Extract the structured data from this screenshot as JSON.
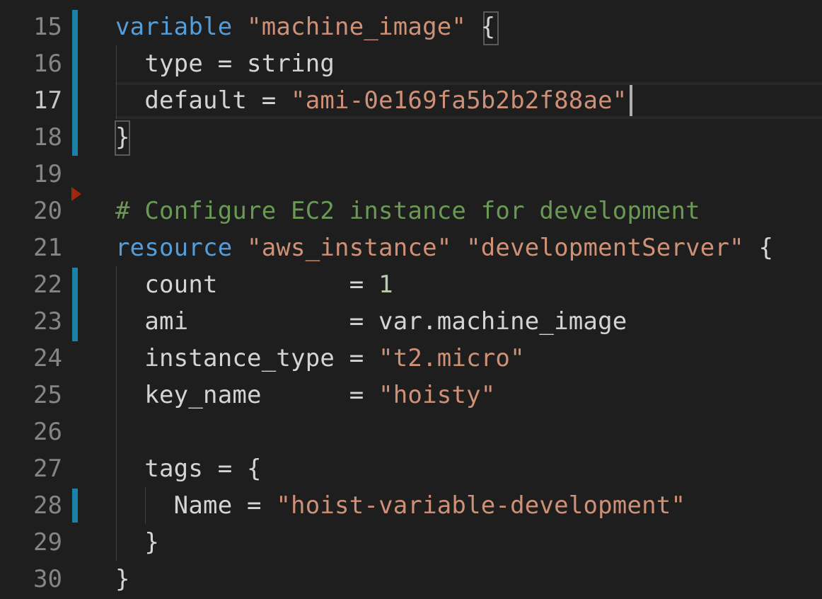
{
  "editor": {
    "theme_colors": {
      "background": "#1e1e1e",
      "keyword": "#569cd6",
      "string": "#ce9178",
      "number": "#b5cea8",
      "comment": "#6a9955",
      "text": "#d4d4d4",
      "line_number": "#858585",
      "modified_gutter": "#1b81a8"
    },
    "lines": [
      {
        "number": "15",
        "tokens": [
          {
            "t": "variable",
            "c": "kw"
          },
          {
            "t": " ",
            "c": "txt"
          },
          {
            "t": "\"machine_image\"",
            "c": "str"
          },
          {
            "t": " ",
            "c": "txt"
          },
          {
            "t": "{",
            "c": "txt"
          }
        ]
      },
      {
        "number": "16",
        "tokens": [
          {
            "t": "  type = string",
            "c": "txt"
          }
        ]
      },
      {
        "number": "17",
        "tokens": [
          {
            "t": "  default = ",
            "c": "txt"
          },
          {
            "t": "\"ami-0e169fa5b2b2f88ae\"",
            "c": "str"
          }
        ]
      },
      {
        "number": "18",
        "tokens": [
          {
            "t": "}",
            "c": "txt"
          }
        ]
      },
      {
        "number": "19",
        "tokens": []
      },
      {
        "number": "20",
        "tokens": [
          {
            "t": "# Configure EC2 instance for development",
            "c": "cmt"
          }
        ]
      },
      {
        "number": "21",
        "tokens": [
          {
            "t": "resource",
            "c": "kw"
          },
          {
            "t": " ",
            "c": "txt"
          },
          {
            "t": "\"aws_instance\"",
            "c": "str"
          },
          {
            "t": " ",
            "c": "txt"
          },
          {
            "t": "\"developmentServer\"",
            "c": "str"
          },
          {
            "t": " {",
            "c": "txt"
          }
        ]
      },
      {
        "number": "22",
        "tokens": [
          {
            "t": "  count         = ",
            "c": "txt"
          },
          {
            "t": "1",
            "c": "num"
          }
        ]
      },
      {
        "number": "23",
        "tokens": [
          {
            "t": "  ami           = var.machine_image",
            "c": "txt"
          }
        ]
      },
      {
        "number": "24",
        "tokens": [
          {
            "t": "  instance_type = ",
            "c": "txt"
          },
          {
            "t": "\"t2.micro\"",
            "c": "str"
          }
        ]
      },
      {
        "number": "25",
        "tokens": [
          {
            "t": "  key_name      = ",
            "c": "txt"
          },
          {
            "t": "\"hoisty\"",
            "c": "str"
          }
        ]
      },
      {
        "number": "26",
        "tokens": []
      },
      {
        "number": "27",
        "tokens": [
          {
            "t": "  tags = {",
            "c": "txt"
          }
        ]
      },
      {
        "number": "28",
        "tokens": [
          {
            "t": "    Name = ",
            "c": "txt"
          },
          {
            "t": "\"hoist-variable-development\"",
            "c": "str"
          }
        ]
      },
      {
        "number": "29",
        "tokens": [
          {
            "t": "  }",
            "c": "txt"
          }
        ]
      },
      {
        "number": "30",
        "tokens": [
          {
            "t": "}",
            "c": "txt"
          }
        ]
      }
    ],
    "active_line": "17",
    "modified_lines": [
      "15",
      "16",
      "17",
      "18",
      "22",
      "23",
      "28"
    ],
    "fold_marker_line": "20"
  }
}
